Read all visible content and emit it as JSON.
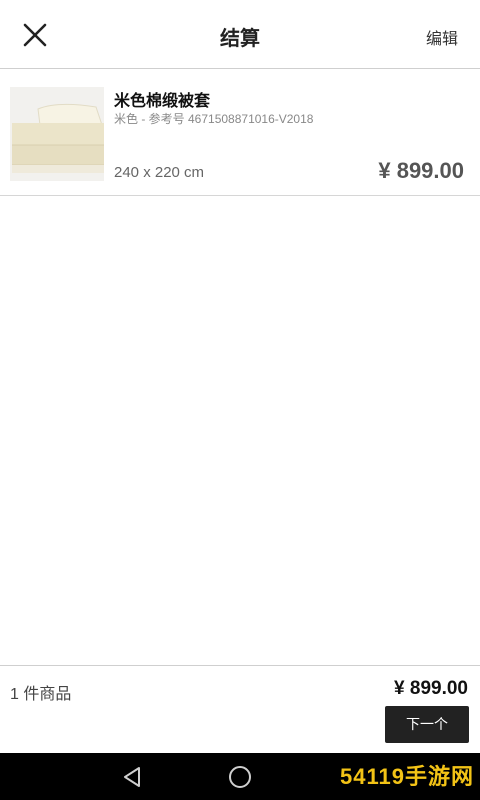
{
  "header": {
    "title": "结算",
    "edit_label": "编辑"
  },
  "cart": {
    "items": [
      {
        "name": "米色棉缎被套",
        "subtitle": "米色 - 参考号 4671508871016-V2018",
        "size": "240 x 220 cm",
        "price": "¥ 899.00"
      }
    ]
  },
  "footer": {
    "count_label": "1 件商品",
    "total": "¥ 899.00",
    "next_label": "下一个"
  },
  "watermark": {
    "text": "54119手游网"
  },
  "icons": {
    "close": "close-icon",
    "back": "back-triangle-icon",
    "home": "home-circle-icon"
  }
}
